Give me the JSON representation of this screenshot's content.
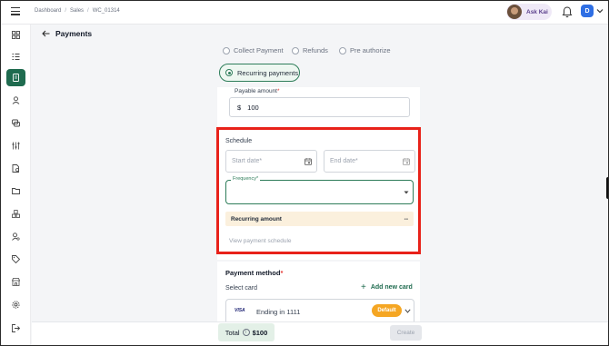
{
  "breadcrumb": [
    "Dashboard",
    "Sales",
    "WC_01314"
  ],
  "topbar": {
    "ask_kai": "Ask Kai",
    "user_initial": "D"
  },
  "page": {
    "title": "Payments"
  },
  "payment_options": [
    {
      "label": "Collect Payment",
      "selected": false
    },
    {
      "label": "Refunds",
      "selected": false
    },
    {
      "label": "Pre authorize",
      "selected": false
    },
    {
      "label": "Recurring payments",
      "selected": true
    }
  ],
  "payable": {
    "label": "Payable amount",
    "currency": "$",
    "value": "100"
  },
  "schedule": {
    "title": "Schedule",
    "start_date_placeholder": "Start date*",
    "end_date_placeholder": "End date*",
    "frequency_label": "Frequency*",
    "frequency_value": "",
    "recurring_amount_label": "Recurring amount",
    "recurring_amount_value": "--",
    "view_schedule": "View payment schedule"
  },
  "payment_method": {
    "title": "Payment method",
    "select_card": "Select card",
    "add_new_card": "Add new card",
    "card": {
      "brand": "VISA",
      "label": "Ending in 1111",
      "badge": "Default"
    }
  },
  "footer": {
    "total_label": "Total",
    "total_value": "$100",
    "create": "Create"
  },
  "colors": {
    "accent": "#1f6b4f",
    "highlight_border": "#e8221a",
    "badge": "#f5a623"
  }
}
